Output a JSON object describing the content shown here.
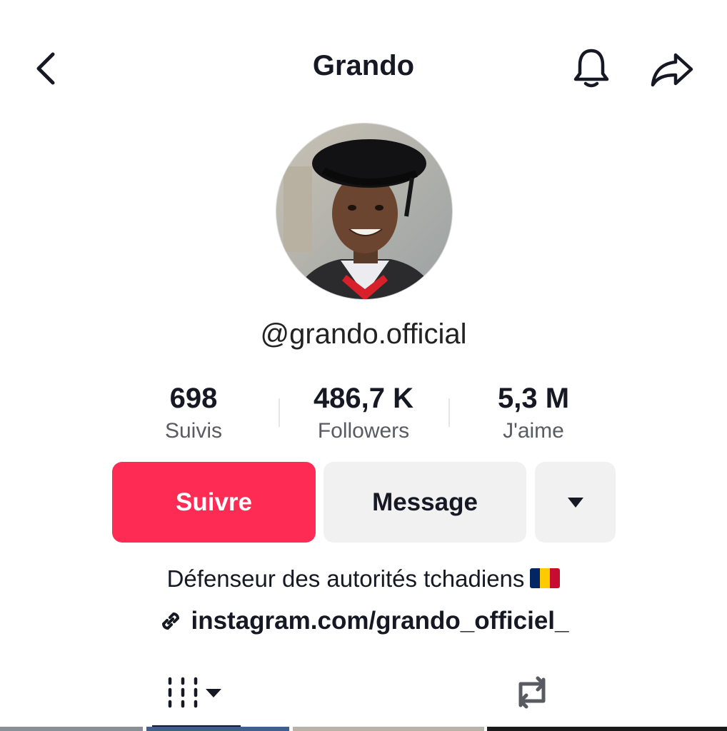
{
  "header": {
    "title": "Grando",
    "back_icon": "chevron-left-icon",
    "notification_icon": "bell-icon",
    "share_icon": "share-arrow-icon"
  },
  "profile": {
    "username": "@grando.official",
    "avatar": "profile-photo"
  },
  "stats": [
    {
      "value": "698",
      "label": "Suivis"
    },
    {
      "value": "486,7 K",
      "label": "Followers"
    },
    {
      "value": "5,3 M",
      "label": "J'aime"
    }
  ],
  "actions": {
    "follow_label": "Suivre",
    "message_label": "Message",
    "more_icon": "caret-down-icon"
  },
  "bio": {
    "text": "Défenseur des autorités tchadiens",
    "flag": "chad-flag"
  },
  "link": {
    "icon": "link-icon",
    "text": "instagram.com/grando_officiel_"
  },
  "tabs": [
    {
      "name": "videos-grid",
      "icon": "grid-bars-icon",
      "active": true
    },
    {
      "name": "reposts",
      "icon": "repost-icon",
      "active": false
    }
  ],
  "colors": {
    "accent": "#fe2c55",
    "text": "#161823",
    "muted": "#5a5b62",
    "button_bg": "#f1f1f2"
  }
}
